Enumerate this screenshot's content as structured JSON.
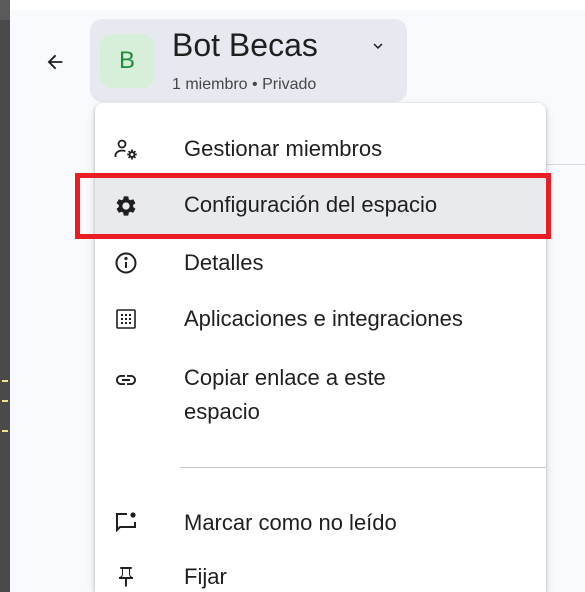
{
  "header": {
    "space_name": "Bot Becas",
    "avatar_letter": "B",
    "subtitle": "1 miembro • Privado"
  },
  "menu": {
    "items": [
      {
        "label": "Gestionar miembros",
        "icon": "manage-members-icon"
      },
      {
        "label": "Configuración del espacio",
        "icon": "settings-gear-icon",
        "highlighted": true
      },
      {
        "label": "Detalles",
        "icon": "info-icon"
      },
      {
        "label": "Aplicaciones e integraciones",
        "icon": "apps-grid-icon"
      },
      {
        "label_line1": "Copiar enlace a este",
        "label_line2": "espacio",
        "icon": "link-icon"
      },
      {
        "label": "Marcar como no leído",
        "icon": "mark-unread-icon"
      },
      {
        "label": "Fijar",
        "icon": "pin-icon"
      }
    ]
  },
  "colors": {
    "annotation_border": "#ea1c24",
    "avatar_bg": "#d7efd9",
    "avatar_text": "#1e8e3e",
    "chip_bg": "#e6e9ef"
  }
}
